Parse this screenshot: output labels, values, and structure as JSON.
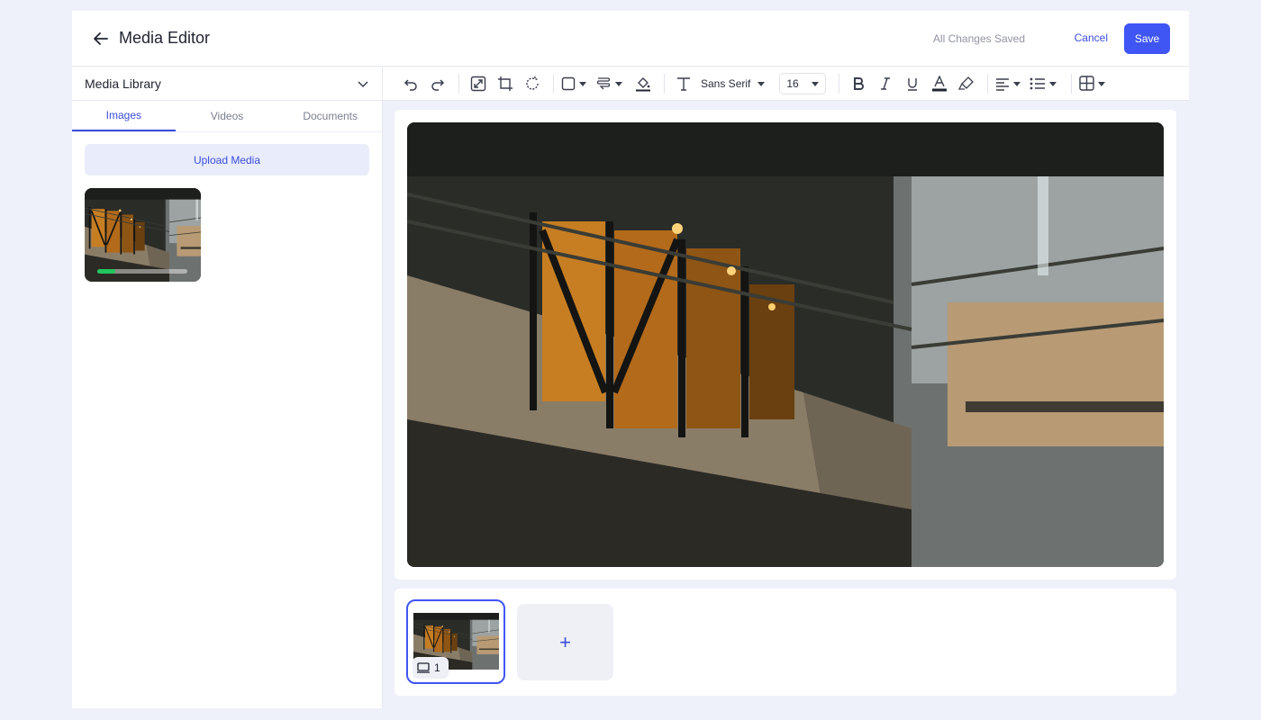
{
  "header": {
    "title": "Media Editor",
    "status": "All Changes Saved",
    "cancel_label": "Cancel",
    "save_label": "Save"
  },
  "sidebar": {
    "library_title": "Media Library",
    "tabs": [
      {
        "label": "Images",
        "active": true
      },
      {
        "label": "Videos",
        "active": false
      },
      {
        "label": "Documents",
        "active": false
      }
    ],
    "upload_label": "Upload Media",
    "items": [
      {
        "type": "image",
        "upload_progress": 0.2
      }
    ]
  },
  "toolbar": {
    "font_family": "Sans Serif",
    "font_size": "16",
    "icons": [
      "undo-icon",
      "redo-icon",
      "resize-icon",
      "crop-icon",
      "rotate-icon",
      "rectangle-icon",
      "stroke-icon",
      "fill-bucket-icon",
      "text-icon",
      "bold-icon",
      "italic-icon",
      "underline-icon",
      "text-color-icon",
      "highlighter-icon",
      "align-left-icon",
      "bullet-list-icon",
      "table-icon"
    ]
  },
  "slides": [
    {
      "number": "1",
      "selected": true
    }
  ],
  "add_slide_label": "+",
  "colors": {
    "accent": "#3f55f4",
    "progress": "#22c55e",
    "background": "#eef1f9"
  }
}
